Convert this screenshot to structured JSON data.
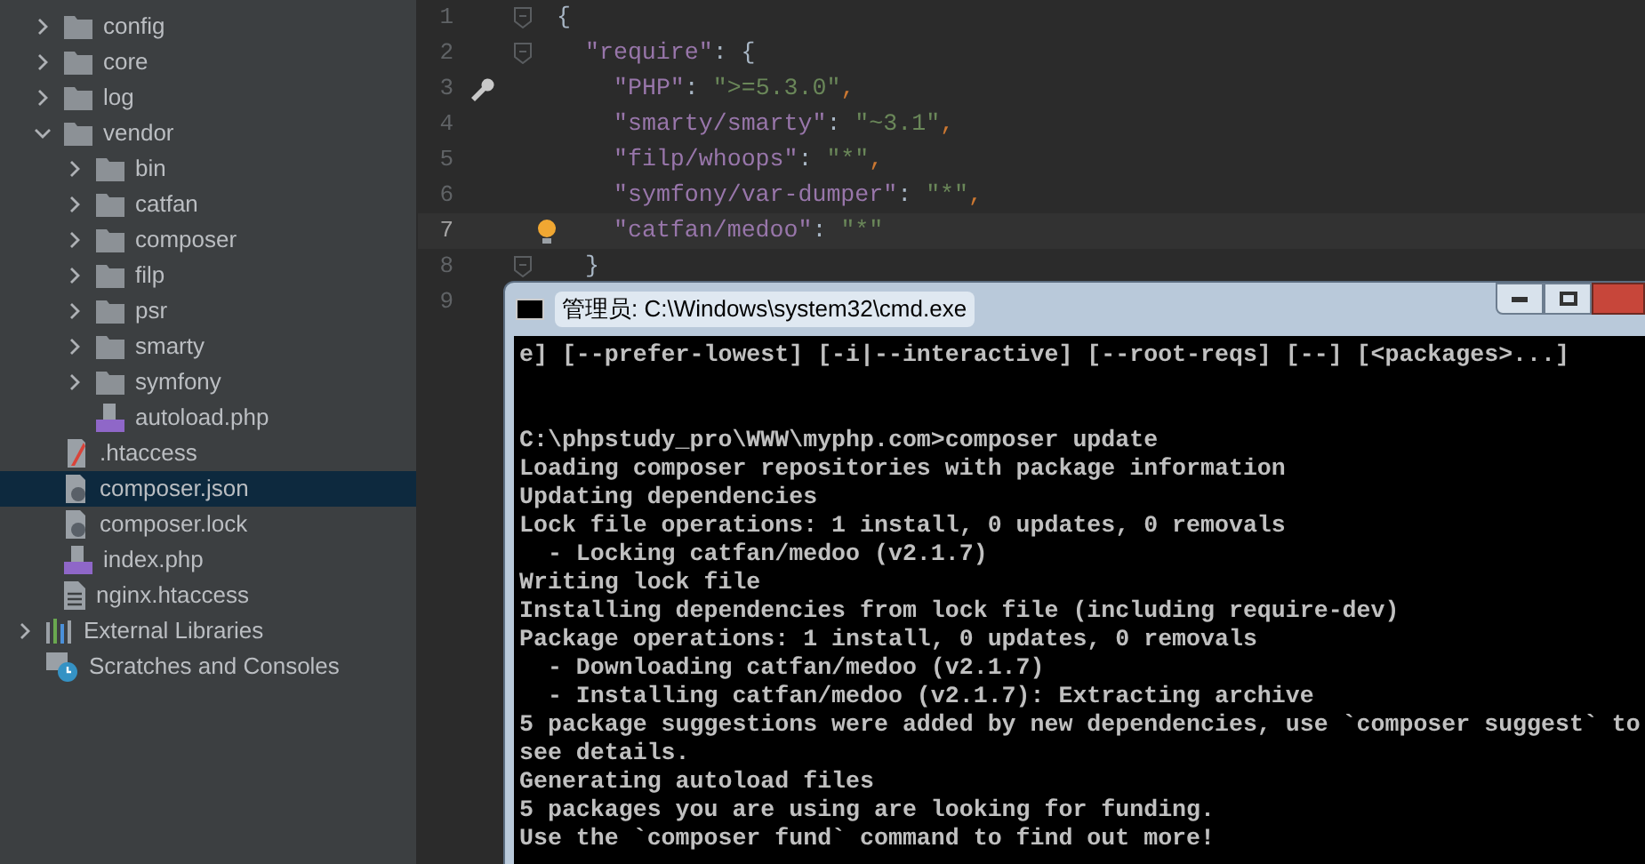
{
  "project_tree": [
    {
      "label": "config",
      "kind": "folder",
      "expanded": false,
      "selected": false
    },
    {
      "label": "core",
      "kind": "folder",
      "expanded": false,
      "selected": false
    },
    {
      "label": "log",
      "kind": "folder",
      "expanded": false,
      "selected": false
    },
    {
      "label": "vendor",
      "kind": "folder",
      "expanded": true,
      "selected": false,
      "children": [
        {
          "label": "bin",
          "kind": "folder",
          "expanded": false,
          "selected": false
        },
        {
          "label": "catfan",
          "kind": "folder",
          "expanded": false,
          "selected": false
        },
        {
          "label": "composer",
          "kind": "folder",
          "expanded": false,
          "selected": false
        },
        {
          "label": "filp",
          "kind": "folder",
          "expanded": false,
          "selected": false
        },
        {
          "label": "psr",
          "kind": "folder",
          "expanded": false,
          "selected": false
        },
        {
          "label": "smarty",
          "kind": "folder",
          "expanded": false,
          "selected": false
        },
        {
          "label": "symfony",
          "kind": "folder",
          "expanded": false,
          "selected": false
        },
        {
          "label": "autoload.php",
          "kind": "php",
          "selected": false
        }
      ]
    },
    {
      "label": ".htaccess",
      "kind": "htaccess",
      "selected": false
    },
    {
      "label": "composer.json",
      "kind": "json",
      "selected": true
    },
    {
      "label": "composer.lock",
      "kind": "json",
      "selected": false
    },
    {
      "label": "index.php",
      "kind": "php",
      "selected": false
    },
    {
      "label": "nginx.htaccess",
      "kind": "text",
      "selected": false
    }
  ],
  "bottom_items": [
    {
      "label": "External Libraries",
      "kind": "libraries",
      "expanded": false
    },
    {
      "label": "Scratches and Consoles",
      "kind": "scratches"
    }
  ],
  "editor": {
    "lines": [
      {
        "number": "1",
        "current": false,
        "fold": true,
        "wrench": false,
        "bulb": false,
        "tokens": [
          {
            "kind": "punct",
            "text": "{"
          }
        ],
        "children": [
          {
            "number": "2",
            "current": false,
            "fold": true,
            "wrench": false,
            "bulb": false,
            "tokens": [
              {
                "kind": "key",
                "text": "\"require\""
              },
              {
                "kind": "punct",
                "text": ": {"
              }
            ],
            "children": [
              {
                "number": "3",
                "current": false,
                "fold": false,
                "wrench": true,
                "bulb": false,
                "tokens": [
                  {
                    "kind": "key",
                    "text": "\"PHP\""
                  },
                  {
                    "kind": "punct",
                    "text": ": "
                  },
                  {
                    "kind": "string",
                    "text": "\">=5.3.0\""
                  },
                  {
                    "kind": "comma",
                    "text": ","
                  }
                ]
              },
              {
                "number": "4",
                "current": false,
                "fold": false,
                "wrench": false,
                "bulb": false,
                "tokens": [
                  {
                    "kind": "key",
                    "text": "\"smarty/smarty\""
                  },
                  {
                    "kind": "punct",
                    "text": ": "
                  },
                  {
                    "kind": "string",
                    "text": "\"~3.1\""
                  },
                  {
                    "kind": "comma",
                    "text": ","
                  }
                ]
              },
              {
                "number": "5",
                "current": false,
                "fold": false,
                "wrench": false,
                "bulb": false,
                "tokens": [
                  {
                    "kind": "key",
                    "text": "\"filp/whoops\""
                  },
                  {
                    "kind": "punct",
                    "text": ": "
                  },
                  {
                    "kind": "string",
                    "text": "\"*\""
                  },
                  {
                    "kind": "comma",
                    "text": ","
                  }
                ]
              },
              {
                "number": "6",
                "current": false,
                "fold": false,
                "wrench": false,
                "bulb": false,
                "tokens": [
                  {
                    "kind": "key",
                    "text": "\"symfony/var-dumper\""
                  },
                  {
                    "kind": "punct",
                    "text": ": "
                  },
                  {
                    "kind": "string",
                    "text": "\"*\""
                  },
                  {
                    "kind": "comma",
                    "text": ","
                  }
                ]
              },
              {
                "number": "7",
                "current": true,
                "fold": false,
                "wrench": false,
                "bulb": true,
                "tokens": [
                  {
                    "kind": "key",
                    "text": "\"catfan/medoo\""
                  },
                  {
                    "kind": "punct",
                    "text": ": "
                  },
                  {
                    "kind": "string",
                    "text": "\"*\""
                  }
                ]
              }
            ]
          },
          {
            "number": "8",
            "current": false,
            "fold": true,
            "wrench": false,
            "bulb": false,
            "tokens": [
              {
                "kind": "punct",
                "text": "}"
              }
            ]
          }
        ]
      },
      {
        "number": "9",
        "current": false
      }
    ]
  },
  "terminal": {
    "title": "管理员: C:\\Windows\\system32\\cmd.exe",
    "blocks": [
      [
        "e] [--prefer-lowest] [-i|--interactive] [--root-reqs] [--] [<packages>...]"
      ],
      [
        "C:\\phpstudy_pro\\WWW\\myphp.com>composer update",
        "Loading composer repositories with package information",
        "Updating dependencies",
        "Lock file operations: 1 install, 0 updates, 0 removals",
        "  - Locking catfan/medoo (v2.1.7)",
        "Writing lock file",
        "Installing dependencies from lock file (including require-dev)",
        "Package operations: 1 install, 0 updates, 0 removals",
        "  - Downloading catfan/medoo (v2.1.7)",
        "  - Installing catfan/medoo (v2.1.7): Extracting archive",
        "5 package suggestions were added by new dependencies, use `composer suggest` to",
        "see details.",
        "Generating autoload files",
        "5 packages you are using are looking for funding.",
        "Use the `composer fund` command to find out more!"
      ]
    ]
  }
}
